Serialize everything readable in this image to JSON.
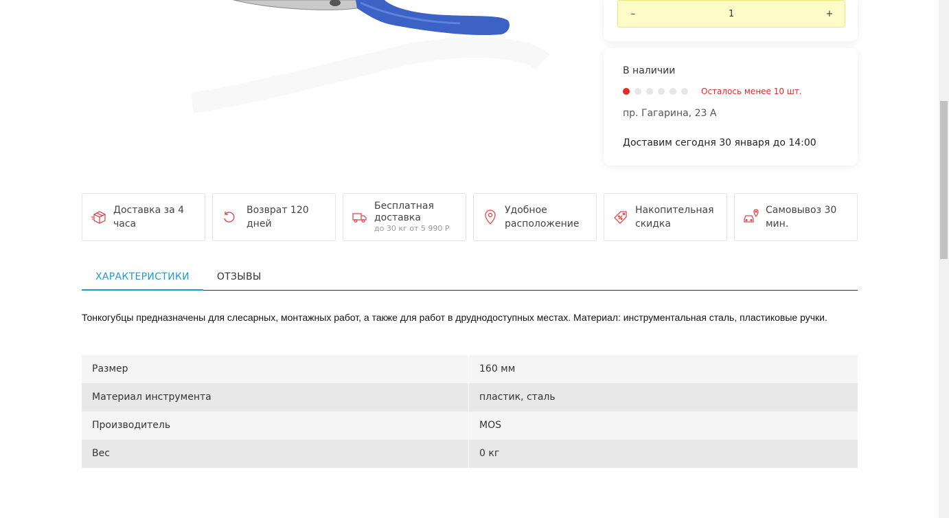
{
  "quantity": {
    "minus_label": "–",
    "value": "1",
    "plus_label": "+"
  },
  "stock": {
    "title": "В наличии",
    "level": 1,
    "level_max": 6,
    "note": "Осталось менее 10 шт.",
    "address": "пр. Гагарина, 23 А",
    "delivery": "Доставим сегодня 30 января до 14:00",
    "accent_color": "#e52a2a"
  },
  "features": [
    {
      "icon": "box-icon",
      "label": "Доставка за 4 часа"
    },
    {
      "icon": "return-icon",
      "label": "Возврат 120 дней"
    },
    {
      "icon": "truck-icon",
      "label": "Бесплатная доставка",
      "sub": "до 30 кг от 5 990 Р"
    },
    {
      "icon": "location-pin-icon",
      "label_line1": "Удобное",
      "label_line2": "расположение"
    },
    {
      "icon": "discount-tag-icon",
      "label_line1": "Накопительная",
      "label_line2": "скидка"
    },
    {
      "icon": "car-pickup-icon",
      "label": "Самовывоз 30 мин."
    }
  ],
  "tabs": [
    {
      "label": "ХАРАКТЕРИСТИКИ",
      "active": true
    },
    {
      "label": "ОТЗЫВЫ",
      "active": false
    }
  ],
  "description": "Тонкогубцы предназначены для слесарных, монтажных работ, а также для работ в друднодоступных местах. Материал: инструментальная сталь, пластиковые ручки.",
  "specs": [
    {
      "key": "Размер",
      "value": "160 мм"
    },
    {
      "key": "Материал инструмента",
      "value": "пластик, сталь"
    },
    {
      "key": "Производитель",
      "value": "MOS"
    },
    {
      "key": "Вес",
      "value": "0 кг"
    }
  ],
  "colors": {
    "tab_active": "#1c9ad6",
    "icon_red": "#e0474c",
    "qty_bg": "#fdfbc8"
  }
}
